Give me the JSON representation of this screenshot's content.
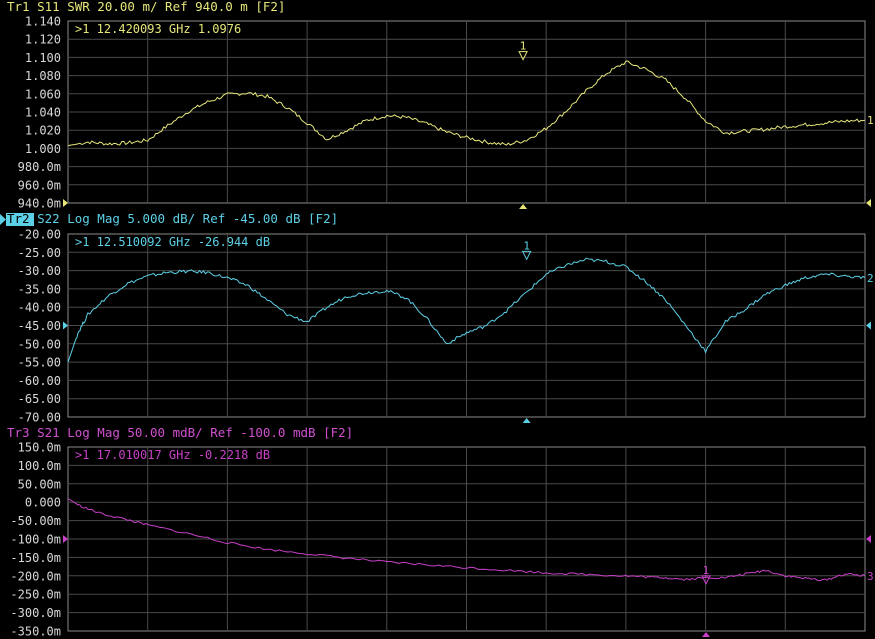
{
  "chart_data": [
    {
      "type": "line",
      "trace": "Tr1",
      "title": "Tr1 S11 SWR 20.00 m/ Ref 940.0 m [F2]",
      "color": "#E6E67A",
      "title_color": "#E6E67A",
      "active": false,
      "ylim": [
        0.94,
        1.14
      ],
      "yticks": [
        "1.140",
        "1.120",
        "1.100",
        "1.080",
        "1.060",
        "1.040",
        "1.020",
        "1.000",
        "980.0m",
        "960.0m",
        "940.0m"
      ],
      "ref_value": 0.94,
      "xlim": [
        1,
        21
      ],
      "marker_readout": ">1  12.420093 GHz  1.0976",
      "marker": {
        "label": "1",
        "x": 12.42,
        "y": 1.0976
      },
      "end_label": "1",
      "series": [
        {
          "x": [
            1,
            1.5,
            2,
            2.5,
            3,
            3.5,
            4,
            4.5,
            5,
            5.5,
            6,
            6.5,
            7,
            7.5,
            8,
            8.5,
            9,
            9.5,
            10,
            10.5,
            11,
            11.5,
            12,
            12.5,
            13,
            13.5,
            14,
            14.5,
            15,
            15.5,
            16,
            16.5,
            17,
            17.5,
            18,
            18.5,
            19,
            19.5,
            20,
            20.5,
            21
          ],
          "values": [
            1.003,
            1.007,
            1.005,
            1.006,
            1.009,
            1.025,
            1.04,
            1.051,
            1.059,
            1.061,
            1.057,
            1.045,
            1.028,
            1.01,
            1.02,
            1.031,
            1.036,
            1.034,
            1.027,
            1.018,
            1.012,
            1.007,
            1.004,
            1.009,
            1.022,
            1.041,
            1.063,
            1.082,
            1.095,
            1.087,
            1.075,
            1.055,
            1.03,
            1.017,
            1.019,
            1.021,
            1.024,
            1.026,
            1.028,
            1.03,
            1.031
          ]
        }
      ]
    },
    {
      "type": "line",
      "trace": "Tr2",
      "title": "Tr2 S22 Log Mag 5.000 dB/ Ref -45.00 dB [F2]",
      "color": "#5CD0E6",
      "title_color": "#5CD0E6",
      "active": true,
      "ylim": [
        -70,
        -20
      ],
      "yticks": [
        "-20.00",
        "-25.00",
        "-30.00",
        "-35.00",
        "-40.00",
        "-45.00",
        "-50.00",
        "-55.00",
        "-60.00",
        "-65.00",
        "-70.00"
      ],
      "ref_value": -45,
      "xlim": [
        1,
        21
      ],
      "marker_readout": ">1  12.510092 GHz -26.944  dB",
      "marker": {
        "label": "1",
        "x": 12.51,
        "y": -26.944
      },
      "end_label": "2",
      "series": [
        {
          "x": [
            1,
            1.25,
            1.5,
            2,
            2.5,
            3,
            3.5,
            4,
            4.5,
            5,
            5.5,
            6,
            6.5,
            7,
            7.5,
            8,
            8.5,
            9,
            9.5,
            10,
            10.5,
            11,
            11.5,
            12,
            12.5,
            13,
            13.5,
            14,
            14.5,
            15,
            15.5,
            16,
            16.5,
            17,
            17.5,
            18,
            18.5,
            19,
            19.5,
            20,
            20.5,
            21
          ],
          "values": [
            -55,
            -47,
            -42,
            -37,
            -33.5,
            -31.5,
            -30.5,
            -30.2,
            -30.5,
            -32,
            -34,
            -38,
            -42,
            -44,
            -40,
            -37,
            -36,
            -35.5,
            -37.5,
            -43,
            -50,
            -47,
            -45,
            -41,
            -36,
            -31,
            -28.5,
            -27,
            -27.5,
            -29,
            -33,
            -38,
            -45,
            -52,
            -44,
            -40.5,
            -36.5,
            -34,
            -32,
            -31,
            -31.5,
            -32
          ]
        }
      ]
    },
    {
      "type": "line",
      "trace": "Tr3",
      "title": "Tr3 S21 Log Mag 50.00 mdB/ Ref -100.0 mdB [F2]",
      "color": "#C840C8",
      "title_color": "#D050D0",
      "active": false,
      "ylim": [
        -350,
        150
      ],
      "yticks": [
        "150.0m",
        "100.0m",
        "50.00m",
        "0.000",
        "-50.00m",
        "-100.0m",
        "-150.0m",
        "-200.0m",
        "-250.0m",
        "-300.0m",
        "-350.0m"
      ],
      "ref_value": -100,
      "xlim": [
        1,
        21
      ],
      "marker_readout": ">1  17.010017 GHz -0.2218  dB",
      "marker": {
        "label": "1",
        "x": 17.01,
        "y": -221.8
      },
      "end_label": "3",
      "series": [
        {
          "x": [
            1,
            1.3,
            1.8,
            2.5,
            3,
            4,
            5,
            6,
            7,
            8,
            9,
            10,
            11,
            12,
            13,
            14,
            15,
            15.5,
            16,
            16.5,
            17,
            17.5,
            18,
            18.5,
            19,
            19.5,
            20,
            20.5,
            21
          ],
          "values": [
            10,
            -10,
            -30,
            -48,
            -62,
            -85,
            -110,
            -128,
            -140,
            -152,
            -163,
            -170,
            -178,
            -185,
            -192,
            -196,
            -200,
            -203,
            -205,
            -210,
            -205,
            -205,
            -195,
            -185,
            -200,
            -207,
            -212,
            -195,
            -200
          ]
        }
      ]
    }
  ]
}
